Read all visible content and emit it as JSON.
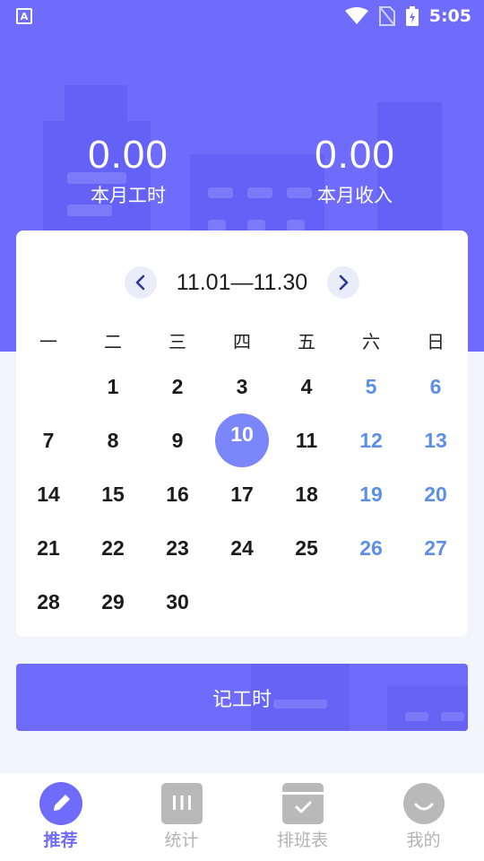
{
  "status_bar": {
    "app_badge": "A",
    "time": "5:05"
  },
  "summary": {
    "hours_value": "0.00",
    "hours_label": "本月工时",
    "income_value": "0.00",
    "income_label": "本月收入"
  },
  "calendar": {
    "range": "11.01—11.30",
    "weekdays": [
      "一",
      "二",
      "三",
      "四",
      "五",
      "六",
      "日"
    ],
    "selected_day": "10",
    "days": [
      "",
      "1",
      "2",
      "3",
      "4",
      "5",
      "6",
      "7",
      "8",
      "9",
      "10",
      "11",
      "12",
      "13",
      "14",
      "15",
      "16",
      "17",
      "18",
      "19",
      "20",
      "21",
      "22",
      "23",
      "24",
      "25",
      "26",
      "27",
      "28",
      "29",
      "30",
      "",
      "",
      "",
      ""
    ]
  },
  "record_button": {
    "label": "记工时"
  },
  "tabs": [
    {
      "label": "推荐",
      "icon": "pencil-icon",
      "active": true
    },
    {
      "label": "统计",
      "icon": "stats-icon",
      "active": false
    },
    {
      "label": "排班表",
      "icon": "schedule-icon",
      "active": false
    },
    {
      "label": "我的",
      "icon": "profile-icon",
      "active": false
    }
  ],
  "colors": {
    "brand": "#6f6cfb",
    "weekend": "#5d8fe6",
    "selected": "#7a86fa"
  }
}
